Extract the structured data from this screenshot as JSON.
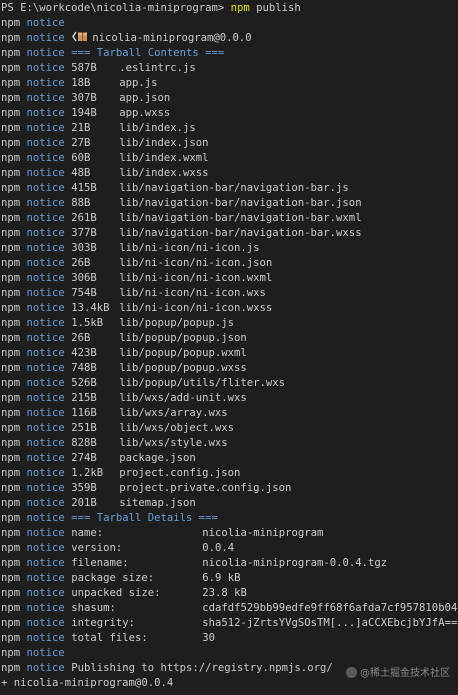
{
  "prompt": {
    "ps": "PS E:\\workcode\\nicolia-miniprogram>",
    "command": "npm",
    "argument": "publish"
  },
  "npm_label": "npm",
  "notice_label": "notice",
  "package_header": "nicolia-miniprogram@0.0.0",
  "contents_title": "=== Tarball Contents ===",
  "files": [
    {
      "size": "587B",
      "path": ".eslintrc.js"
    },
    {
      "size": "18B",
      "path": "app.js"
    },
    {
      "size": "307B",
      "path": "app.json"
    },
    {
      "size": "194B",
      "path": "app.wxss"
    },
    {
      "size": "21B",
      "path": "lib/index.js"
    },
    {
      "size": "27B",
      "path": "lib/index.json"
    },
    {
      "size": "60B",
      "path": "lib/index.wxml"
    },
    {
      "size": "48B",
      "path": "lib/index.wxss"
    },
    {
      "size": "415B",
      "path": "lib/navigation-bar/navigation-bar.js"
    },
    {
      "size": "88B",
      "path": "lib/navigation-bar/navigation-bar.json"
    },
    {
      "size": "261B",
      "path": "lib/navigation-bar/navigation-bar.wxml"
    },
    {
      "size": "377B",
      "path": "lib/navigation-bar/navigation-bar.wxss"
    },
    {
      "size": "303B",
      "path": "lib/ni-icon/ni-icon.js"
    },
    {
      "size": "26B",
      "path": "lib/ni-icon/ni-icon.json"
    },
    {
      "size": "306B",
      "path": "lib/ni-icon/ni-icon.wxml"
    },
    {
      "size": "754B",
      "path": "lib/ni-icon/ni-icon.wxs"
    },
    {
      "size": "13.4kB",
      "path": "lib/ni-icon/ni-icon.wxss"
    },
    {
      "size": "1.5kB",
      "path": "lib/popup/popup.js"
    },
    {
      "size": "26B",
      "path": "lib/popup/popup.json"
    },
    {
      "size": "423B",
      "path": "lib/popup/popup.wxml"
    },
    {
      "size": "748B",
      "path": "lib/popup/popup.wxss"
    },
    {
      "size": "526B",
      "path": "lib/popup/utils/fliter.wxs"
    },
    {
      "size": "215B",
      "path": "lib/wxs/add-unit.wxs"
    },
    {
      "size": "116B",
      "path": "lib/wxs/array.wxs"
    },
    {
      "size": "251B",
      "path": "lib/wxs/object.wxs"
    },
    {
      "size": "828B",
      "path": "lib/wxs/style.wxs"
    },
    {
      "size": "274B",
      "path": "package.json"
    },
    {
      "size": "1.2kB",
      "path": "project.config.json"
    },
    {
      "size": "359B",
      "path": "project.private.config.json"
    },
    {
      "size": "201B",
      "path": "sitemap.json"
    }
  ],
  "details_title": "=== Tarball Details ===",
  "details": [
    {
      "key": "name:",
      "value": "nicolia-miniprogram"
    },
    {
      "key": "version:",
      "value": "0.0.4"
    },
    {
      "key": "filename:",
      "value": "nicolia-miniprogram-0.0.4.tgz"
    },
    {
      "key": "package size:",
      "value": "6.9 kB"
    },
    {
      "key": "unpacked size:",
      "value": "23.8 kB"
    },
    {
      "key": "shasum:",
      "value": "cdafdf529bb99edfe9ff68f6afda7cf957810b04"
    },
    {
      "key": "integrity:",
      "value": "sha512-jZrtsYVgSOsTM[...]aCCXEbcjbYJfA=="
    },
    {
      "key": "total files:",
      "value": "30"
    }
  ],
  "publishing": "Publishing to https://registry.npmjs.org/",
  "result": "+ nicolia-miniprogram@0.0.4",
  "watermark": "@稀土掘金技术社区",
  "icons": {
    "package": "package-icon",
    "watermark": "juejin-logo-icon"
  },
  "colors": {
    "background": "#1e1e1e",
    "text": "#cccccc",
    "notice": "#6a9fd6",
    "command": "#e5e510"
  }
}
